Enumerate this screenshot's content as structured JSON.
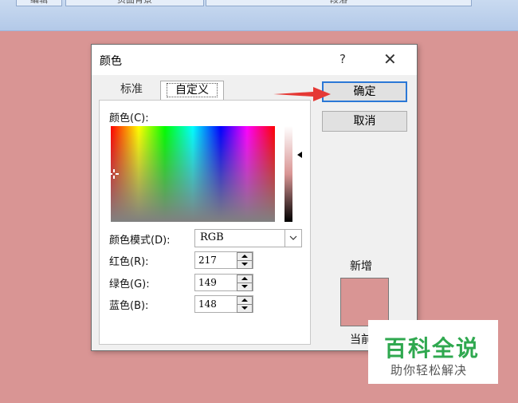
{
  "ribbon": {
    "tabs": [
      "编辑",
      "页面背景",
      "段落"
    ]
  },
  "dialog": {
    "title": "颜色",
    "help_label": "?",
    "close_label": "✕",
    "tabs": [
      {
        "label": "标准"
      },
      {
        "label": "自定义"
      }
    ],
    "colors_label": "颜色(C):",
    "color_model_label": "颜色模式(D):",
    "color_model_value": "RGB",
    "red_label": "红色(R):",
    "green_label": "绿色(G):",
    "blue_label": "蓝色(B):",
    "red_value": "217",
    "green_value": "149",
    "blue_value": "148",
    "ok_label": "确定",
    "cancel_label": "取消",
    "new_label": "新增",
    "current_label": "当前",
    "current_color": "#d99594"
  },
  "watermark": {
    "title": "百科全说",
    "subtitle": "助你轻松解决"
  },
  "colors": {
    "background": "#d99594",
    "arrow": "#e53935",
    "accent": "#2b78d6"
  }
}
